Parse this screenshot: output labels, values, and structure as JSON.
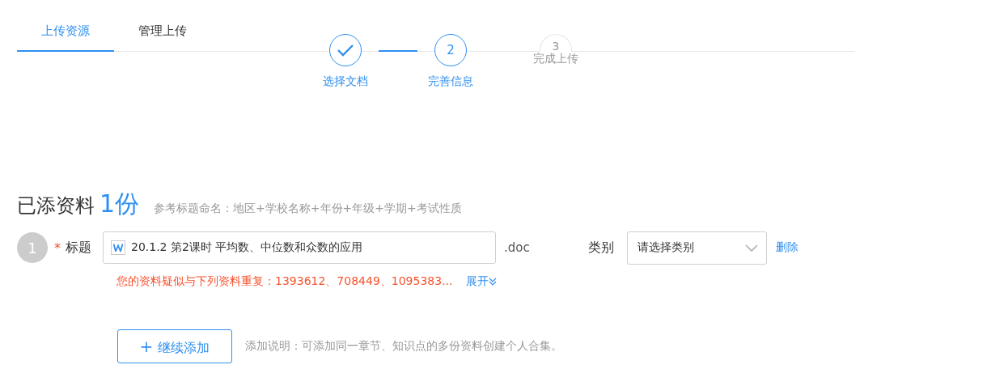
{
  "tabs": [
    {
      "label": "上传资源",
      "selected": true
    },
    {
      "label": "管理上传",
      "selected": false
    }
  ],
  "steps": [
    {
      "label": "选择文档",
      "done": true,
      "active": false
    },
    {
      "number": "2",
      "label": "完善信息",
      "done": false,
      "active": true
    },
    {
      "number": "3",
      "label": "完成上传",
      "done": false,
      "active": false
    }
  ],
  "heading": {
    "title": "已添资料",
    "count": "1份",
    "hint": "参考标题命名：地区+学校名称+年份+年级+学期+考试性质"
  },
  "items": [
    {
      "index": "1",
      "required_mark": "*",
      "title_label": "标题",
      "title_value": "20.1.2 第2课时 平均数、中位数和众数的应用",
      "extension": ".doc",
      "category_label": "类别",
      "category_placeholder": "请选择类别",
      "delete_link": "删除",
      "warning": "您的资料疑似与下列资料重复：1393612、708449、1095383...",
      "expand_link": "展开"
    }
  ],
  "add_button": {
    "icon": "+",
    "label": "继续添加"
  },
  "add_note": "添加说明：可添加同一章节、知识点的多份资料创建个人合集。"
}
